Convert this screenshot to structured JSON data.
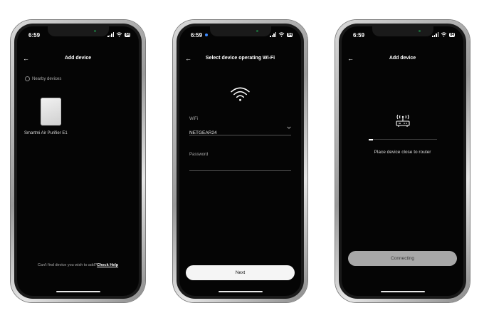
{
  "status": {
    "time": "6:59",
    "battery": "84"
  },
  "screen1": {
    "title": "Add device",
    "nearby_label": "Nearby devices",
    "device_name": "Smartmi Air Purifier E1",
    "footer_text": "Can't find device you wish to add?",
    "footer_link": "Check Help"
  },
  "screen2": {
    "title": "Select device operating Wi-Fi",
    "wifi_label": "WiFi",
    "wifi_value": "NETGEAR24",
    "password_label": "Password",
    "next_button": "Next"
  },
  "screen3": {
    "title": "Add device",
    "progress": 0.06,
    "message": "Place device close to router",
    "connecting_button": "Connecting"
  }
}
